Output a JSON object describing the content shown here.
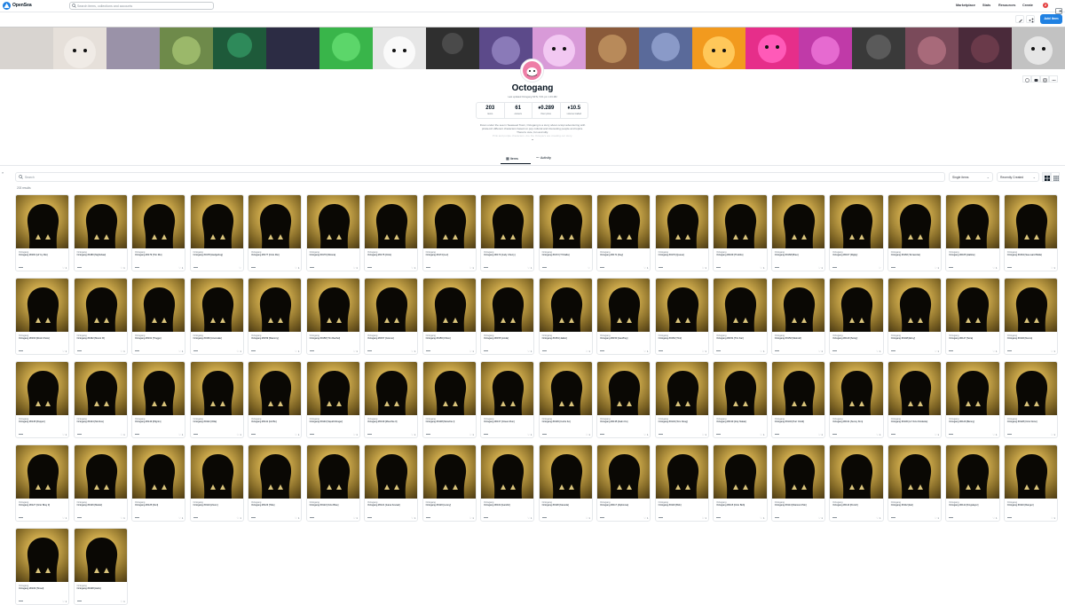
{
  "header": {
    "brand": "OpenSea",
    "search_placeholder": "Search items, collections and accounts",
    "nav": [
      "Marketplace",
      "Stats",
      "Resources",
      "Create"
    ],
    "notification_count": "2",
    "add_item_label": "Add item"
  },
  "collection": {
    "name": "Octogang",
    "subtitle": "Last updated Octogang NFTs, 5:01 pm 1.03.182",
    "stats": [
      {
        "value": "203",
        "label": "items"
      },
      {
        "value": "61",
        "label": "owners"
      },
      {
        "value": "0.289",
        "label": "floor price"
      },
      {
        "value": "10.5",
        "label": "volume traded"
      }
    ],
    "description_lines": [
      "Down under the sea in Seaweed Town, Octogang is a story about octopi adventuring with",
      "pirate-ish different characters based on pop cultural and interesting people and topics.",
      "There're cute, fun and silly."
    ],
    "description_fade": "Pink and purple characters. Are the Octopie's are creating our story."
  },
  "tabs": [
    {
      "label": "Items"
    },
    {
      "label": "Activity"
    }
  ],
  "filters": {
    "search_placeholder": "Search",
    "sale_type": "Single items",
    "sort": "Recently Created"
  },
  "results_label": "203 results",
  "card_collection": "Octogang",
  "cards": [
    {
      "name": "Octogang #0181 [Lil' by Rio]",
      "likes": "1"
    },
    {
      "name": "Octogang #0180 [Nightclaw]",
      "likes": "1"
    },
    {
      "name": "Octogang #0179 [Trin Rio]",
      "likes": "1"
    },
    {
      "name": "Octogang #0178 [Hedgehog]",
      "likes": ""
    },
    {
      "name": "Octogang #0177 [Octo Rio]",
      "likes": "1"
    },
    {
      "name": "Octogang #0176 [Woona]",
      "likes": "1"
    },
    {
      "name": "Octogang #0175 [Octo]",
      "likes": "1"
    },
    {
      "name": "Octogang #0174 [Luz]",
      "likes": "1"
    },
    {
      "name": "Octogang #0173 [Judy Cherry]",
      "likes": "1"
    },
    {
      "name": "Octogang #0172 [T'Challa]",
      "likes": ""
    },
    {
      "name": "Octogang #0171 [Kay]",
      "likes": "1"
    },
    {
      "name": "Octogang #0170 [Queue]",
      "likes": "1"
    },
    {
      "name": "Octogang #0169 [Thubbo]",
      "likes": "1"
    },
    {
      "name": "Octogang #0168 [Breo]",
      "likes": "1"
    },
    {
      "name": "Octogang #0167 [Rigby]",
      "likes": ""
    },
    {
      "name": "Octogang #0166 [Terracotta]",
      "likes": "1"
    },
    {
      "name": "Octogang #0165 [Hallow]",
      "likes": "1"
    },
    {
      "name": "Octogang #0164 [Sea-ward Bella]",
      "likes": "1"
    },
    {
      "name": "Octogang #0163 [Rock Chow]",
      "likes": "1"
    },
    {
      "name": "Octogang #0162 [Mooni III]",
      "likes": "1"
    },
    {
      "name": "Octogang #0161 [Troggo]",
      "likes": "1"
    },
    {
      "name": "Octogang #0160 [Anomalie]",
      "likes": "1"
    },
    {
      "name": "Octogang #0159 [Slammy]",
      "likes": "1"
    },
    {
      "name": "Octogang #0158 [Trin Rachel]",
      "likes": "1"
    },
    {
      "name": "Octogang #0157 [Cosmo]",
      "likes": "1"
    },
    {
      "name": "Octogang #0156 [Chico]",
      "likes": "1"
    },
    {
      "name": "Octogang #0155 [Linda]",
      "likes": "1"
    },
    {
      "name": "Octogang #0154 [Jakko]",
      "likes": "1"
    },
    {
      "name": "Octogang #0153 [Geoffrey]",
      "likes": "1"
    },
    {
      "name": "Octogang #0152 [Trini]",
      "likes": "1"
    },
    {
      "name": "Octogang #0151 [Trin Kar]",
      "likes": "1"
    },
    {
      "name": "Octogang #0150 [Metroid]",
      "likes": "1"
    },
    {
      "name": "Octogang #0149 [Sooty]",
      "likes": "1"
    },
    {
      "name": "Octogang #0148 [Elroy]",
      "likes": "1"
    },
    {
      "name": "Octogang #0147 [Sora]",
      "likes": "1"
    },
    {
      "name": "Octogang #0146 [Nemo]",
      "likes": "1"
    },
    {
      "name": "Octogang #0145 [Pepper]",
      "likes": "1"
    },
    {
      "name": "Octogang #0144 [Nimbus]",
      "likes": "1"
    },
    {
      "name": "Octogang #0143 [Pilgrim]",
      "likes": "1"
    },
    {
      "name": "Octogang #0142 [Ollie]",
      "likes": "1"
    },
    {
      "name": "Octogang #0141 [Gil Bo]",
      "likes": "1"
    },
    {
      "name": "Octogang #0140 [Squid Monger]",
      "likes": "1"
    },
    {
      "name": "Octogang #0139 [Moochie II]",
      "likes": "1"
    },
    {
      "name": "Octogang #0138 [Moochie I]",
      "likes": "1"
    },
    {
      "name": "Octogang #0137 [Ocean Run]",
      "likes": "1"
    },
    {
      "name": "Octogang #0136 [Curtis Ko]",
      "likes": "1"
    },
    {
      "name": "Octogang #0135 [Kalm Ko]",
      "likes": "1"
    },
    {
      "name": "Octogang #0134 [Tom Doug]",
      "likes": "1"
    },
    {
      "name": "Octogang #0133 [Inky Nakai]",
      "likes": "1"
    },
    {
      "name": "Octogang #0132 [Purr Octdi]",
      "likes": "1"
    },
    {
      "name": "Octogang #0131 [Sunny Kim]",
      "likes": "1"
    },
    {
      "name": "Octogang #0130 [Lil' Octo Nicolette]",
      "likes": "1"
    },
    {
      "name": "Octogang #0129 [Benny]",
      "likes": "1"
    },
    {
      "name": "Octogang #0128 [Octo Dono]",
      "likes": "1"
    },
    {
      "name": "Octogang #0127 [Octo Bray 3]",
      "likes": "1"
    },
    {
      "name": "Octogang #0126 [Mariel]",
      "likes": "1"
    },
    {
      "name": "Octogang #0125 [Nuri]",
      "likes": "1"
    },
    {
      "name": "Octogang #0124 [Zoom]",
      "likes": "1"
    },
    {
      "name": "Octogang #0123 [Tide]",
      "likes": "1"
    },
    {
      "name": "Octogang #0122 [Octo Blue]",
      "likes": "1"
    },
    {
      "name": "Octogang #0121 [Ivana Kovaal]",
      "likes": "1"
    },
    {
      "name": "Octogang #0120 [Loony]",
      "likes": "1"
    },
    {
      "name": "Octogang #0119 [Gambit]",
      "likes": "1"
    },
    {
      "name": "Octogang #0118 [Kaneda]",
      "likes": "1"
    },
    {
      "name": "Octogang #0117 [Alphonse]",
      "likes": "1"
    },
    {
      "name": "Octogang #0116 [Bob]",
      "likes": "1"
    },
    {
      "name": "Octogang #0115 [Octo Bob]",
      "likes": "1"
    },
    {
      "name": "Octogang #0114 [Diamond Mo]",
      "likes": "1"
    },
    {
      "name": "Octogang #0113 [Pencil]",
      "likes": "1"
    },
    {
      "name": "Octogang #0112 [Eel]",
      "likes": "1"
    },
    {
      "name": "Octogang #0111 [Kingslayer]",
      "likes": "1"
    },
    {
      "name": "Octogang #0110 [Ranger]",
      "likes": "1"
    },
    {
      "name": "Octogang #0109 [Tinsel]",
      "likes": "1"
    },
    {
      "name": "Octogang #0108 [Helix]",
      "likes": "1"
    }
  ]
}
